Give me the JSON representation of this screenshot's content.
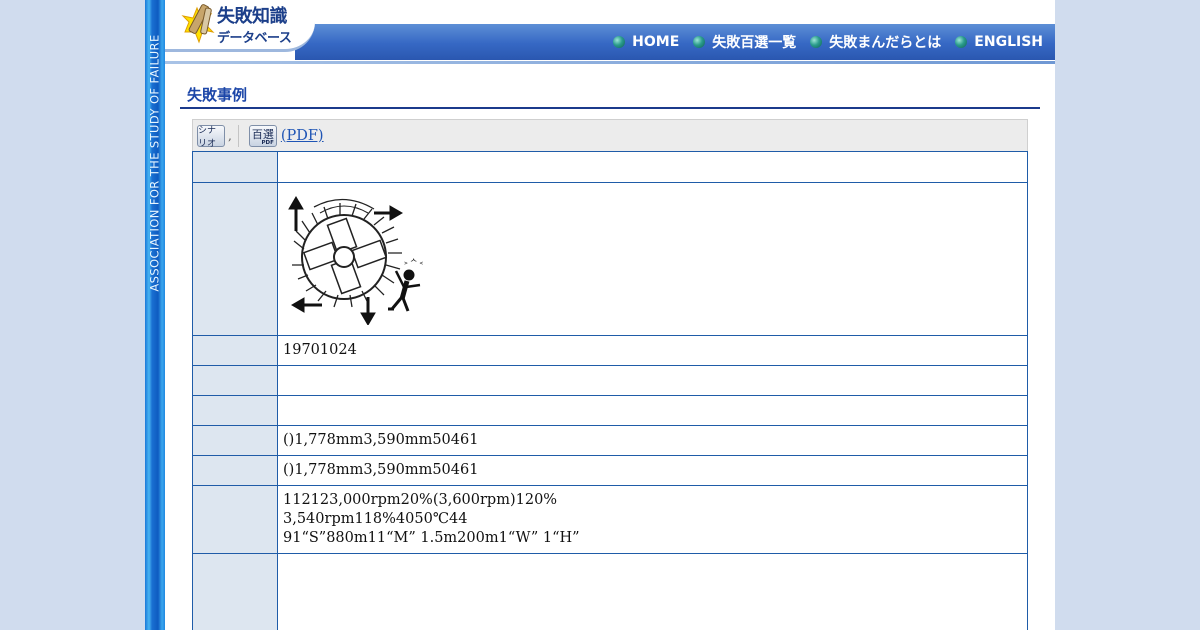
{
  "sidebar": {
    "text": "ASSOCIATION FOR THE STUDY OF FAILURE"
  },
  "logo": {
    "line1": "失敗知識",
    "line2": "データベース"
  },
  "nav": [
    {
      "label": "HOME"
    },
    {
      "label": "失敗百選一覧"
    },
    {
      "label": "失敗まんだらとは"
    },
    {
      "label": "ENGLISH"
    }
  ],
  "section_title": "失敗事例",
  "toolbar": {
    "scenario_button": "シナリオ",
    "separator": ",",
    "hyakusen_button": "百選",
    "hyakusen_sub": "PDF",
    "pdf_link": " (PDF) "
  },
  "rows": [
    {
      "value": ""
    },
    {
      "value": "",
      "image": "turbine-rotor-burst-illustration"
    },
    {
      "value": "19701024"
    },
    {
      "value": ""
    },
    {
      "value": ""
    },
    {
      "value": "()1,778mm3,590mm50461"
    },
    {
      "value": "()1,778mm3,590mm50461"
    },
    {
      "lines": [
        "112123,000rpm20%(3,600rpm)120%",
        "3,540rpm118%4050℃44",
        "91“S”880m11“M” 1.5m200m1“W” 1“H”"
      ]
    },
    {
      "value": ""
    }
  ],
  "colors": {
    "page_bg": "#d0dcee",
    "header_blue": "#3668c4",
    "title_blue": "#1c46a8",
    "table_border": "#1f5ca8",
    "label_cell_bg": "#dde6f0",
    "link": "#1f55b5"
  }
}
